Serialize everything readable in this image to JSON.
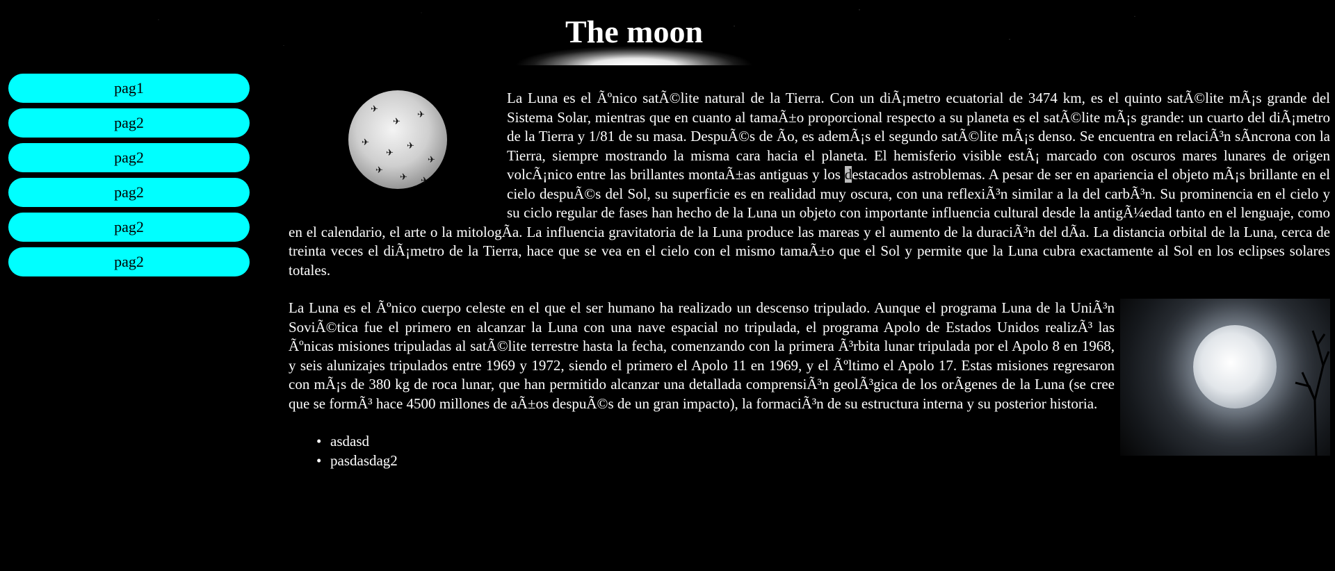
{
  "header": {
    "title": "The moon"
  },
  "nav": {
    "items": [
      {
        "label": "pag1"
      },
      {
        "label": "pag2"
      },
      {
        "label": "pag2"
      },
      {
        "label": "pag2"
      },
      {
        "label": "pag2"
      },
      {
        "label": "pag2"
      }
    ]
  },
  "content": {
    "p1": "La Luna es el Ãºnico satÃ©lite natural de la Tierra. Con un diÃ¡metro ecuatorial de 3474 km, es el quinto satÃ©lite mÃ¡s grande del Sistema Solar, mientras que en cuanto al tamaÃ±o proporcional respecto a su planeta es el satÃ©lite mÃ¡s grande: un cuarto del diÃ¡metro de la Tierra y 1/81 de su masa. DespuÃ©s de Ão, es ademÃ¡s el segundo satÃ©lite mÃ¡s denso. Se encuentra en relaciÃ³n sÃncrona con la Tierra, siempre mostrando la misma cara hacia el planeta. El hemisferio visible estÃ¡ marcado con oscuros mares lunares de origen volcÃ¡nico entre las brillantes montaÃ±as antiguas y los ",
    "p1_highlight": "d",
    "p1_rest": "estacados astroblemas. A pesar de ser en apariencia el objeto mÃ¡s brillante en el cielo despuÃ©s del Sol, su superficie es en realidad muy oscura, con una reflexiÃ³n similar a la del carbÃ³n. Su prominencia en el cielo y su ciclo regular de fases han hecho de la Luna un objeto con importante influencia cultural desde la antigÃ¼edad tanto en el lenguaje, como en el calendario, el arte o la mitologÃa. La influencia gravitatoria de la Luna produce las mareas y el aumento de la duraciÃ³n del dÃa. La distancia orbital de la Luna, cerca de treinta veces el diÃ¡metro de la Tierra, hace que se vea en el cielo con el mismo tamaÃ±o que el Sol y permite que la Luna cubra exactamente al Sol en los eclipses solares totales.",
    "p2": "La Luna es el Ãºnico cuerpo celeste en el que el ser humano ha realizado un descenso tripulado. Aunque el programa Luna de la UniÃ³n SoviÃ©tica fue el primero en alcanzar la Luna con una nave espacial no tripulada, el programa Apolo de Estados Unidos realizÃ³ las Ãºnicas misiones tripuladas al satÃ©lite terrestre hasta la fecha, comenzando con la primera Ã³rbita lunar tripulada por el Apolo 8 en 1968, y seis alunizajes tripulados entre 1969 y 1972, siendo el primero el Apolo 11 en 1969, y el Ãºltimo el Apolo 17. Estas misiones regresaron con mÃ¡s de 380 kg de roca lunar, que han permitido alcanzar una detallada comprensiÃ³n geolÃ³gica de los orÃgenes de la Luna (se cree que se formÃ³ hace 4500 millones de aÃ±os despuÃ©s de un gran impacto), la formaciÃ³n de su estructura interna y su posterior historia.",
    "list": [
      "asdasd",
      "pasdasdag2"
    ]
  },
  "colors": {
    "background": "#000000",
    "text": "#ffffff",
    "nav_button": "#00ffff",
    "nav_text": "#000000"
  }
}
